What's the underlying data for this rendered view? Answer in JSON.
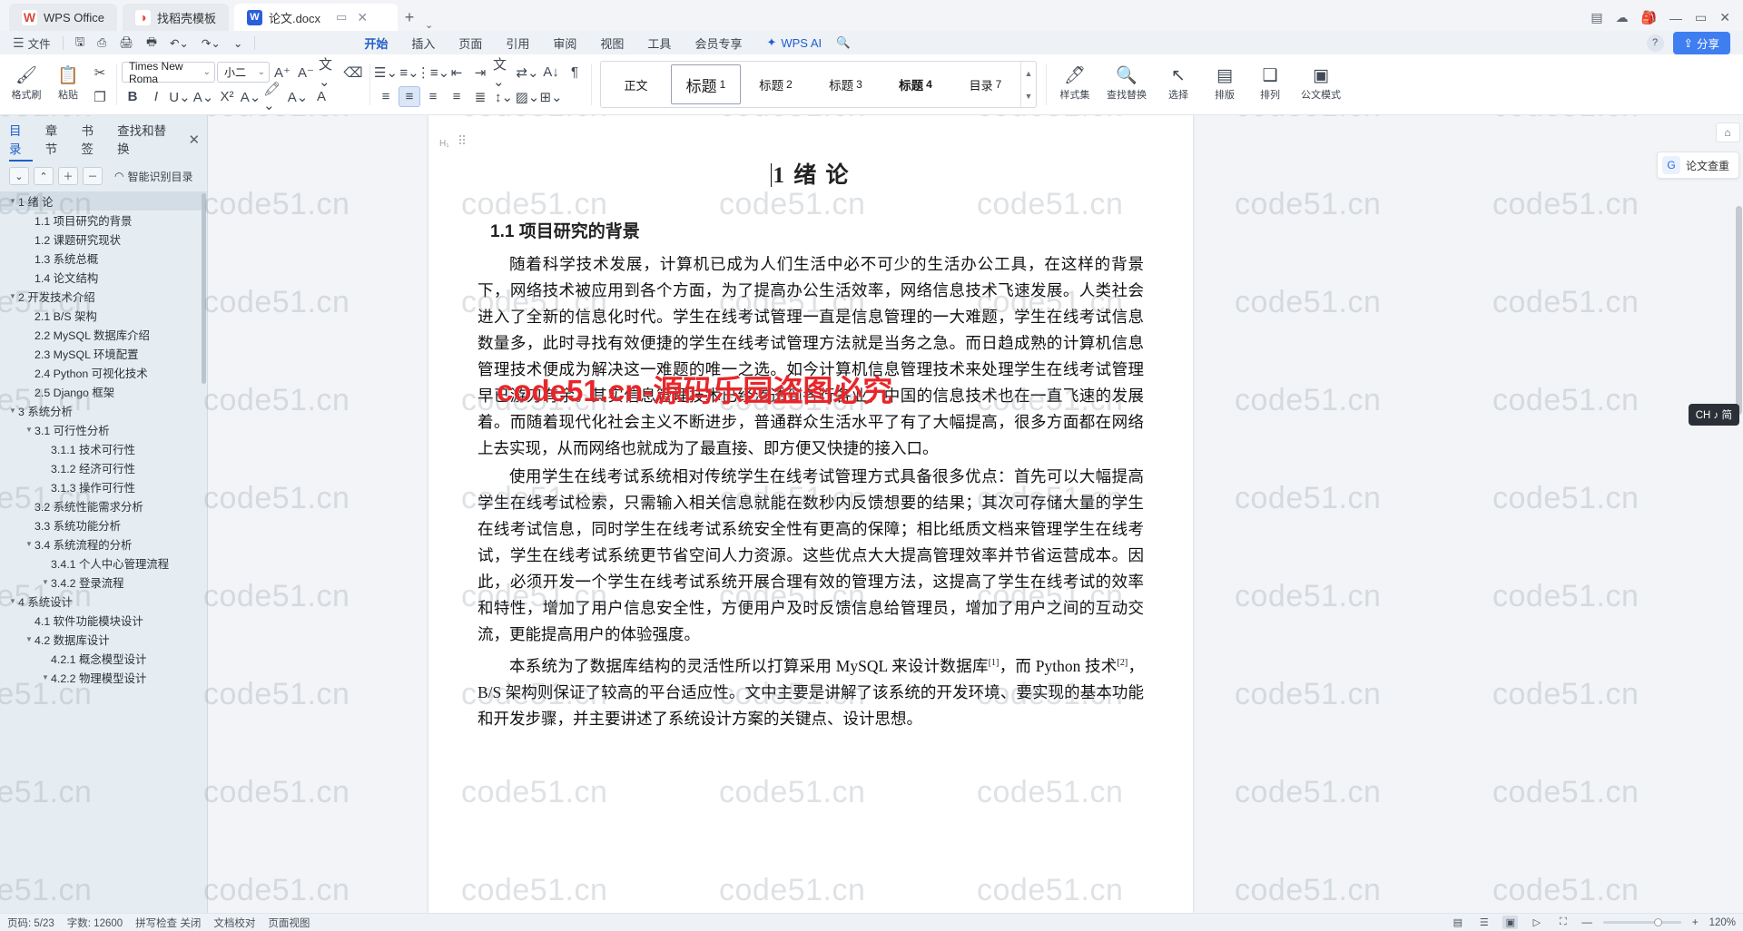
{
  "titlebar": {
    "tabs": [
      {
        "label": "WPS Office",
        "icon": "wps-logo-icon"
      },
      {
        "label": "找稻壳模板",
        "icon": "template-icon"
      },
      {
        "label": "论文.docx",
        "icon": "word-doc-icon"
      }
    ],
    "new_tab": "+",
    "dropdown": "⌄",
    "window_controls": {
      "restore_small": "▭",
      "minimize": "—",
      "maximize": "▭",
      "close": "✕"
    },
    "right_icons": [
      "comment-icon",
      "cloud-icon",
      "backpack-icon"
    ]
  },
  "menubar": {
    "file_menu": "文件",
    "quick_icons": [
      "save-icon",
      "save-as-cloud-icon",
      "print-icon",
      "print-preview-icon",
      "undo-icon",
      "redo-icon",
      "customize-icon"
    ],
    "tabs": [
      {
        "label": "开始",
        "selected": true
      },
      {
        "label": "插入",
        "selected": false
      },
      {
        "label": "页面",
        "selected": false
      },
      {
        "label": "引用",
        "selected": false
      },
      {
        "label": "审阅",
        "selected": false
      },
      {
        "label": "视图",
        "selected": false
      },
      {
        "label": "工具",
        "selected": false
      },
      {
        "label": "会员专享",
        "selected": false
      }
    ],
    "ai_label": "WPS AI",
    "search_icon": "search-icon",
    "help_icon": "help-icon",
    "share_label": "分享",
    "accent_color": "#2060c8",
    "share_color": "#3f7ef0"
  },
  "ribbon": {
    "clipboard": [
      {
        "label": "格式刷",
        "icon": "format-painter-icon"
      },
      {
        "label": "粘贴",
        "icon": "paste-icon"
      }
    ],
    "cut_icon": "scissors-icon",
    "copy_icon": "copy-icon",
    "font_name": "Times New Roma",
    "font_size": "小二",
    "font_buttons": [
      "increase-font-icon",
      "decrease-font-icon",
      "pinyin-guide-icon",
      "clear-format-icon"
    ],
    "format_buttons": [
      "bold-icon",
      "italic-icon",
      "underline-icon",
      "strikethrough-icon",
      "superscript-icon",
      "text-effects-icon",
      "highlight-icon",
      "font-color-icon",
      "character-shading-icon"
    ],
    "paragraph_buttons": [
      "bullets-icon",
      "numbering-icon",
      "multilevel-list-icon",
      "decrease-indent-icon",
      "increase-indent-icon",
      "align-left-icon",
      "align-center-icon",
      "align-right-icon",
      "justify-icon",
      "distribute-icon",
      "line-spacing-icon",
      "shading-icon",
      "borders-icon"
    ],
    "extra_buttons": [
      "phonetic-icon",
      "text-direction-icon",
      "sort-icon",
      "show-marks-icon"
    ],
    "styles": [
      {
        "label": "正文",
        "num": "",
        "selected": false
      },
      {
        "label": "标题",
        "num": "1",
        "selected": true
      },
      {
        "label": "标题",
        "num": "2",
        "selected": false
      },
      {
        "label": "标题",
        "num": "3",
        "selected": false
      },
      {
        "label": "标题",
        "num": "4",
        "selected": false
      },
      {
        "label": "目录",
        "num": "7",
        "selected": false
      }
    ],
    "right_tools": [
      {
        "label": "样式集",
        "icon": "style-set-icon"
      },
      {
        "label": "查找替换",
        "icon": "search-replace-icon"
      },
      {
        "label": "选择",
        "icon": "select-icon"
      },
      {
        "label": "排版",
        "icon": "typeset-icon"
      },
      {
        "label": "排列",
        "icon": "arrange-icon"
      },
      {
        "label": "公文模式",
        "icon": "official-doc-icon"
      }
    ]
  },
  "navpane": {
    "tabs": [
      {
        "label": "目录",
        "selected": true
      },
      {
        "label": "章节",
        "selected": false
      },
      {
        "label": "书签",
        "selected": false
      },
      {
        "label": "查找和替换",
        "selected": false
      }
    ],
    "close_icon": "close-icon",
    "tools": [
      "collapse-down-icon",
      "collapse-up-icon",
      "expand-plus-icon",
      "collapse-minus-icon"
    ],
    "smart_label": "智能识别目录",
    "items": [
      {
        "text": "1 绪   论",
        "level": 1,
        "arrow": "▼",
        "selected": true
      },
      {
        "text": "1.1 项目研究的背景",
        "level": 2,
        "arrow": "",
        "selected": false
      },
      {
        "text": "1.2 课题研究现状",
        "level": 2,
        "arrow": "",
        "selected": false
      },
      {
        "text": "1.3 系统总概",
        "level": 2,
        "arrow": "",
        "selected": false
      },
      {
        "text": "1.4 论文结构",
        "level": 2,
        "arrow": "",
        "selected": false
      },
      {
        "text": "2 开发技术介绍",
        "level": 1,
        "arrow": "▼",
        "selected": false
      },
      {
        "text": "2.1 B/S 架构",
        "level": 2,
        "arrow": "",
        "selected": false
      },
      {
        "text": "2.2 MySQL 数据库介绍",
        "level": 2,
        "arrow": "",
        "selected": false
      },
      {
        "text": "2.3 MySQL 环境配置",
        "level": 2,
        "arrow": "",
        "selected": false
      },
      {
        "text": "2.4 Python 可视化技术",
        "level": 2,
        "arrow": "",
        "selected": false
      },
      {
        "text": "2.5 Django 框架",
        "level": 2,
        "arrow": "",
        "selected": false
      },
      {
        "text": "3 系统分析",
        "level": 1,
        "arrow": "▼",
        "selected": false
      },
      {
        "text": "3.1 可行性分析",
        "level": 2,
        "arrow": "▼",
        "selected": false
      },
      {
        "text": "3.1.1 技术可行性",
        "level": 3,
        "arrow": "",
        "selected": false
      },
      {
        "text": "3.1.2 经济可行性",
        "level": 3,
        "arrow": "",
        "selected": false
      },
      {
        "text": "3.1.3 操作可行性",
        "level": 3,
        "arrow": "",
        "selected": false
      },
      {
        "text": "3.2 系统性能需求分析",
        "level": 2,
        "arrow": "",
        "selected": false
      },
      {
        "text": "3.3 系统功能分析",
        "level": 2,
        "arrow": "",
        "selected": false
      },
      {
        "text": "3.4 系统流程的分析",
        "level": 2,
        "arrow": "▼",
        "selected": false
      },
      {
        "text": "3.4.1 个人中心管理流程",
        "level": 3,
        "arrow": "",
        "selected": false
      },
      {
        "text": "3.4.2 登录流程",
        "level": 3,
        "arrow": "▼",
        "selected": false
      },
      {
        "text": "4 系统设计",
        "level": 1,
        "arrow": "▼",
        "selected": false
      },
      {
        "text": "4.1 软件功能模块设计",
        "level": 2,
        "arrow": "",
        "selected": false
      },
      {
        "text": "4.2 数据库设计",
        "level": 2,
        "arrow": "▼",
        "selected": false
      },
      {
        "text": "4.2.1 概念模型设计",
        "level": 3,
        "arrow": "",
        "selected": false
      },
      {
        "text": "4.2.2 物理模型设计",
        "level": 3,
        "arrow": "▼",
        "selected": false
      }
    ]
  },
  "document": {
    "heading1": "绪   论",
    "heading1_number": "1",
    "heading2": "1.1 项目研究的背景",
    "heading_mark": "H₁",
    "paragraphs": [
      "随着科学技术发展，计算机已成为人们生活中必不可少的生活办公工具，在这样的背景下，网络技术被应用到各个方面，为了提高办公生活效率，网络信息技术飞速发展。人类社会进入了全新的信息化时代。学生在线考试管理一直是信息管理的一大难题，学生在线考试信息数量多，此时寻找有效便捷的学生在线考试管理方法就是当务之急。而日趋成熟的计算机信息管理技术便成为解决这一难题的唯一之选。如今计算机信息管理技术来处理学生在线考试管理早已游刃有余。其实信息管理技术已经渗透到各行各业，中国的信息技术也在一直飞速的发展着。而随着现代化社会主义不断进步，普通群众生活水平了有了大幅提高，很多方面都在网络上去实现，从而网络也就成为了最直接、即方便又快捷的接入口。",
      "使用学生在线考试系统相对传统学生在线考试管理方式具备很多优点：首先可以大幅提高学生在线考试检索，只需输入相关信息就能在数秒内反馈想要的结果；其次可存储大量的学生在线考试信息，同时学生在线考试系统安全性有更高的保障；相比纸质文档来管理学生在线考试，学生在线考试系统更节省空间人力资源。这些优点大大提高管理效率并节省运营成本。因此，必须开发一个学生在线考试系统开展合理有效的管理方法，这提高了学生在线考试的效率和特性，增加了用户信息安全性，方便用户及时反馈信息给管理员，增加了用户之间的互动交流，更能提高用户的体验强度。"
    ],
    "paragraph3_parts": {
      "a": "本系统为了数据库结构的灵活性所以打算采用 MySQL 来设计数据库",
      "sup1": "[1]",
      "b": "，而 Python 技术",
      "sup2": "[2]",
      "c": "，B/S 架构则保证了较高的平台适应性。文中主要是讲解了该系统的开发环境、要实现的基本功能和开发步骤，并主要讲述了系统设计方案的关键点、设计思想。"
    }
  },
  "rightpanel": {
    "collapse_icon": "collapse-panel-icon",
    "ai_card_label": "论文查重",
    "ai_card_icon": "ai-check-icon",
    "ime_badge": "CH ♪ 简"
  },
  "statusbar": {
    "page": "页码: 5/23",
    "words": "字数: 12600",
    "spellcheck": "拼写检查 关闭",
    "doc_mode": "文档校对",
    "layout_mode": "页面视图",
    "view_icons": [
      "web-layout-icon",
      "outline-icon",
      "print-layout-icon",
      "reading-icon",
      "fullscreen-icon"
    ],
    "zoom": "120%",
    "zoom_minus": "—",
    "zoom_plus": "+"
  },
  "watermarks": {
    "text": "code51.cn",
    "red_text": "code51.cn-源码乐园盗图必究",
    "color": "#e8262a"
  }
}
